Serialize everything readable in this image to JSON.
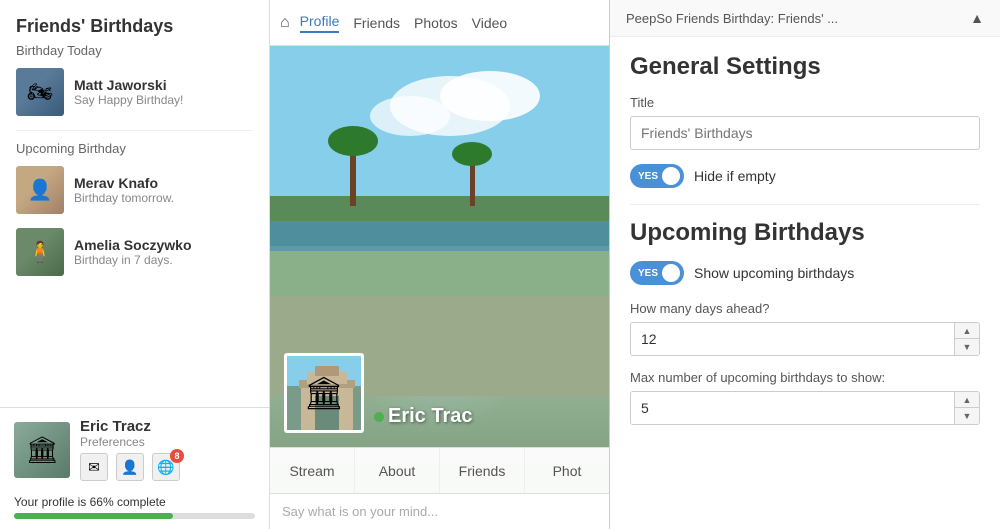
{
  "left": {
    "widget_title": "Friends' Birthdays",
    "birthday_today_label": "Birthday Today",
    "birthday_today": [
      {
        "name": "Matt Jaworski",
        "desc": "Say Happy Birthday!"
      }
    ],
    "upcoming_label": "Upcoming Birthday",
    "upcoming": [
      {
        "name": "Merav Knafo",
        "desc": "Birthday tomorrow."
      },
      {
        "name": "Amelia Soczywko",
        "desc": "Birthday in 7 days."
      }
    ]
  },
  "user": {
    "name": "Eric Tracz",
    "pref_label": "Preferences",
    "badge_count": "8",
    "profile_complete_text": "Your profile is 66% complete",
    "profile_percent": 66
  },
  "nav": {
    "home_icon": "⌂",
    "links": [
      "Profile",
      "Friends",
      "Photos",
      "Video"
    ]
  },
  "cover": {
    "profile_name": "Eric Trac",
    "online": true
  },
  "tabs": {
    "items": [
      "Stream",
      "About",
      "Friends",
      "Phot"
    ]
  },
  "status_input": {
    "placeholder": "Say what is on your mind..."
  },
  "right": {
    "panel_title": "PeepSo Friends Birthday: Friends' ...",
    "collapse_icon": "▲",
    "general_settings_title": "General Settings",
    "title_field_label": "Title",
    "title_field_value": "Friends' Birthdays",
    "hide_if_empty_label": "Hide if empty",
    "toggle_yes": "YES",
    "upcoming_section_title": "Upcoming Birthdays",
    "show_upcoming_label": "Show upcoming birthdays",
    "days_ahead_label": "How many days ahead?",
    "days_ahead_value": "12",
    "max_show_label": "Max number of upcoming birthdays to show:",
    "max_show_value": "5"
  }
}
